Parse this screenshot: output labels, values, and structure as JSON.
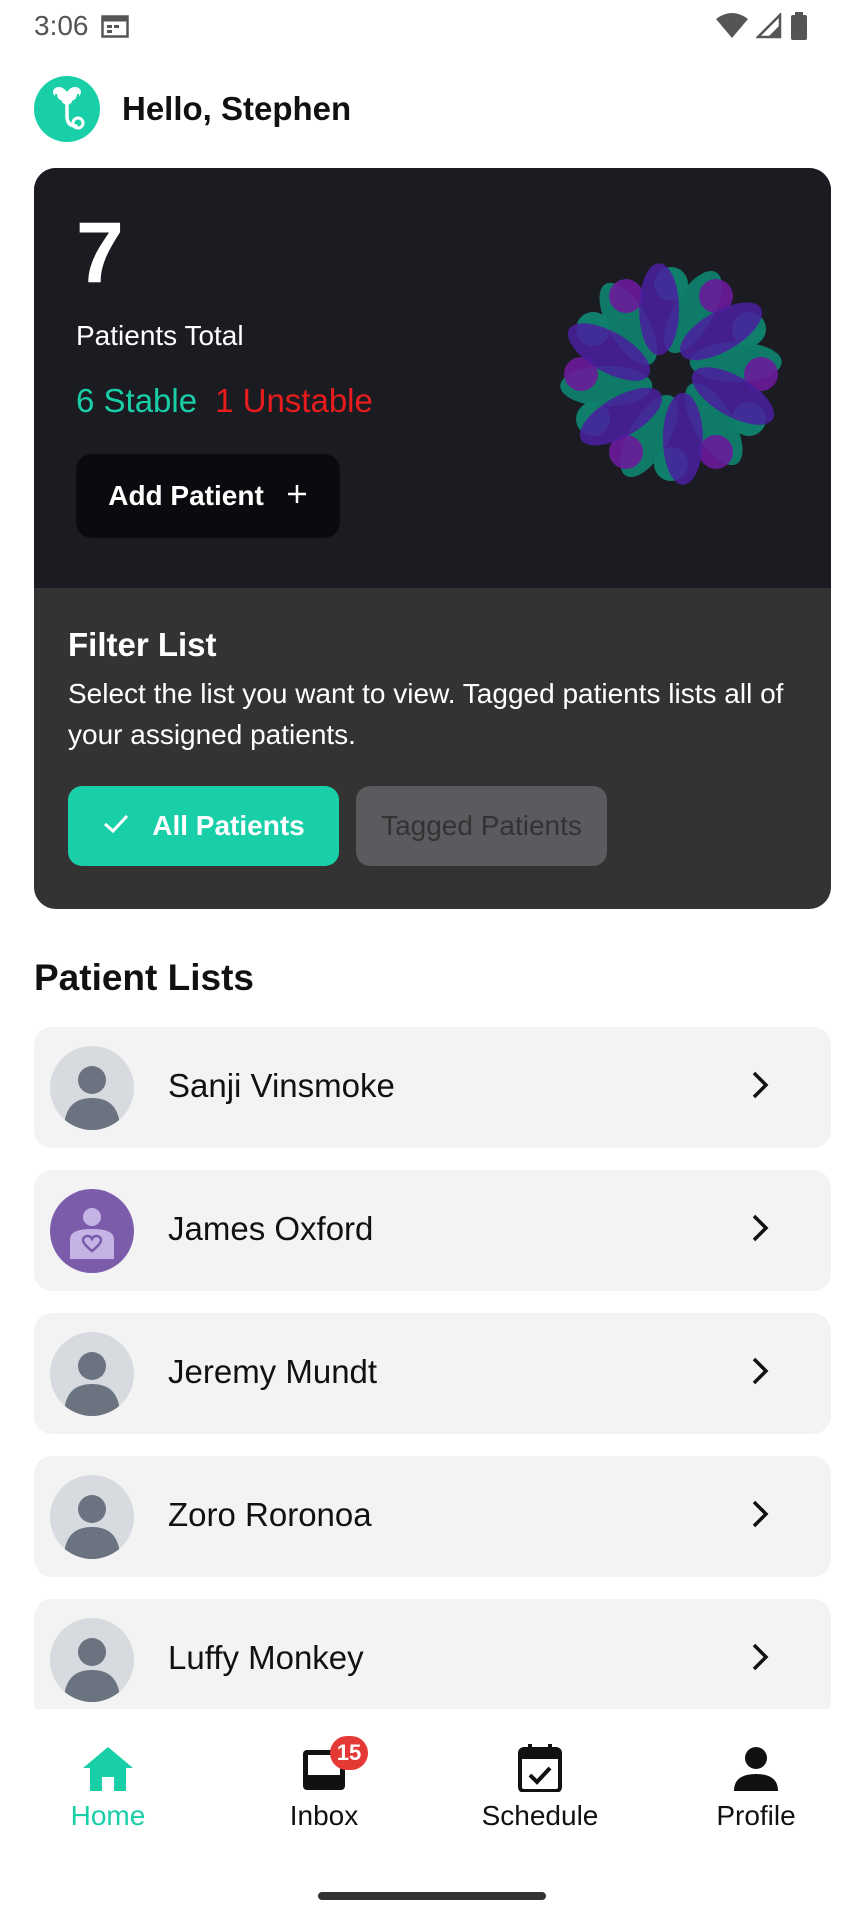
{
  "status_bar": {
    "time": "3:06"
  },
  "header": {
    "greeting": "Hello, Stephen"
  },
  "summary": {
    "total_count": "7",
    "total_label": "Patients Total",
    "stable_label": "6 Stable",
    "unstable_label": "1 Unstable",
    "add_button_label": "Add Patient",
    "colors": {
      "stable": "#19cfa8",
      "unstable": "#e81c1c"
    }
  },
  "filter": {
    "title": "Filter List",
    "description": "Select the list you want to view. Tagged patients lists all of your assigned patients.",
    "options": [
      {
        "label": "All Patients",
        "selected": true
      },
      {
        "label": "Tagged Patients",
        "selected": false
      }
    ]
  },
  "patient_lists": {
    "title": "Patient Lists",
    "patients": [
      {
        "name": "Sanji Vinsmoke",
        "avatar": "person-placeholder-icon"
      },
      {
        "name": "James Oxford",
        "avatar": "patient-heart-icon"
      },
      {
        "name": "Jeremy Mundt",
        "avatar": "person-placeholder-icon"
      },
      {
        "name": "Zoro Roronoa",
        "avatar": "person-placeholder-icon"
      },
      {
        "name": "Luffy Monkey",
        "avatar": "person-placeholder-icon"
      }
    ]
  },
  "bottom_nav": {
    "items": [
      {
        "label": "Home",
        "icon": "home-icon",
        "active": true
      },
      {
        "label": "Inbox",
        "icon": "inbox-icon",
        "badge": "15",
        "active": false
      },
      {
        "label": "Schedule",
        "icon": "calendar-check-icon",
        "active": false
      },
      {
        "label": "Profile",
        "icon": "person-icon",
        "active": false
      }
    ]
  },
  "theme": {
    "accent": "#19cfa8",
    "card_dark": "#1b1b22",
    "card_filter": "#333333"
  }
}
